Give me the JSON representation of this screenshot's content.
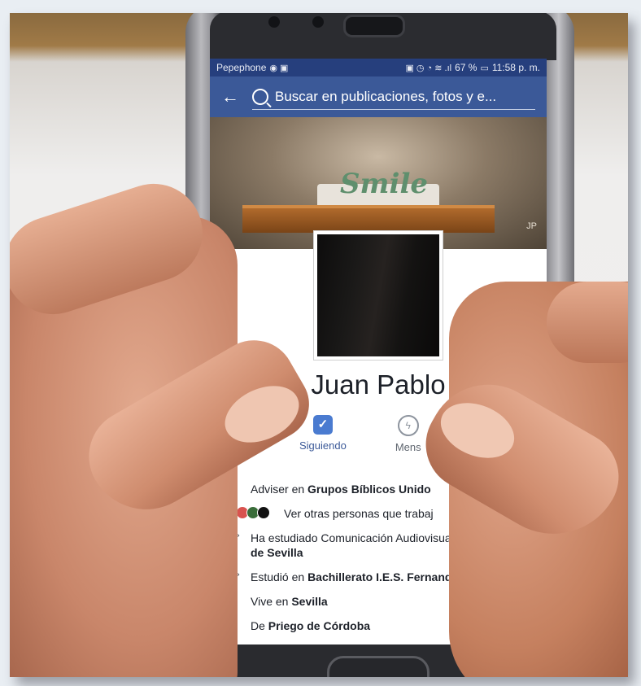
{
  "status_bar": {
    "carrier": "Pepephone",
    "battery": "67 %",
    "time": "11:58 p. m."
  },
  "search": {
    "placeholder": "Buscar en publicaciones, fotos y e..."
  },
  "cover": {
    "sign_text": "Smile",
    "initials": "JP"
  },
  "profile": {
    "name": "Juan Pablo"
  },
  "actions": {
    "follow_label": "Siguiendo",
    "message_label": "Mens"
  },
  "info": {
    "work_prefix": "Adviser en ",
    "work_bold": "Grupos Bíblicos Unido",
    "coworkers": "Ver otras personas que trabaj",
    "studied_prefix": "Ha estudiado Comunicación Audiovisual en ",
    "studied_bold": "Universidad de Sevilla",
    "highschool_prefix": "Estudió en ",
    "highschool_bold": "Bachillerato I.E.S. Fernando III El Santo",
    "lives_prefix": "Vive en ",
    "lives_bold": "Sevilla",
    "from_prefix": "De ",
    "from_bold": "Priego de Córdoba"
  },
  "colors": {
    "facebook_blue": "#3b5998",
    "status_bar": "#263f7d"
  }
}
